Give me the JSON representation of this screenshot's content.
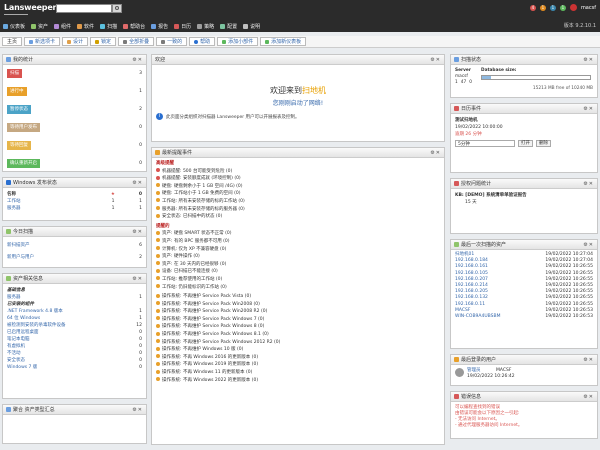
{
  "header": {
    "logo": "Lansweeper",
    "version": "版本 9.2.10.1",
    "username": "macsf",
    "badges": [
      {
        "count": "4",
        "color": "#d9534f"
      },
      {
        "count": "1",
        "color": "#e08a1e"
      },
      {
        "count": "1",
        "color": "#3a87ad"
      },
      {
        "count": "1",
        "color": "#5cb85c"
      }
    ]
  },
  "nav": [
    {
      "label": "仪表板",
      "icon": "dashboard-icon"
    },
    {
      "label": "资产",
      "icon": "assets-icon"
    },
    {
      "label": "组件",
      "icon": "components-icon"
    },
    {
      "label": "软件",
      "icon": "software-icon"
    },
    {
      "label": "扫描",
      "icon": "scan-icon"
    },
    {
      "label": "帮助台",
      "icon": "helpdesk-icon"
    },
    {
      "label": "报告",
      "icon": "reports-icon"
    },
    {
      "label": "日历",
      "icon": "calendar-icon"
    },
    {
      "label": "策略",
      "icon": "policy-icon"
    },
    {
      "label": "配置",
      "icon": "config-icon"
    },
    {
      "label": "说明",
      "icon": "help-icon"
    }
  ],
  "toolbar": [
    {
      "label": "主页",
      "icon": "home-icon"
    },
    {
      "label": "新选项卡",
      "icon": "tab-icon"
    },
    {
      "label": "设计",
      "icon": "design-icon"
    },
    {
      "label": "锁定",
      "icon": "lock-icon"
    },
    {
      "label": "全部折叠",
      "icon": "collapse-icon"
    },
    {
      "label": "一致的",
      "icon": "align-icon"
    },
    {
      "label": "帮助",
      "icon": "help-icon"
    },
    {
      "label": "添加小部件",
      "icon": "add-widget-icon"
    },
    {
      "label": "添加新仪表板",
      "icon": "add-dashboard-icon"
    }
  ],
  "left": {
    "status_panel": {
      "title": "我的统计",
      "items": [
        {
          "label": "扫描",
          "color": "#d9534f",
          "value": "3"
        },
        {
          "label": "进行中",
          "color": "#e8a02a",
          "value": "1"
        },
        {
          "label": "暂停状态",
          "color": "#4ba3c7",
          "value": "2"
        },
        {
          "label": "等待用户发布",
          "color": "#c5a882",
          "value": "0"
        },
        {
          "label": "等待回复",
          "color": "#e6b54a",
          "value": "0"
        },
        {
          "label": "确认重新开启",
          "color": "#5cb85c",
          "value": "0"
        }
      ]
    },
    "windows_panel": {
      "title": "Windows 发布状态",
      "headers": [
        "名称",
        "★",
        "0"
      ],
      "rows": [
        {
          "label": "工作站",
          "a": "1",
          "b": "1"
        },
        {
          "label": "服务器",
          "a": "1",
          "b": "1"
        }
      ]
    },
    "tag_panel": {
      "title": "今日扫描",
      "rows": [
        {
          "label": "新扫描资产",
          "value": "6"
        },
        {
          "label": "新用户与用户",
          "value": "2"
        }
      ]
    },
    "assets_panel": {
      "title": "资产相关信息",
      "sections": [
        {
          "head": "基础信息",
          "rows": [
            {
              "label": "服务器",
              "value": "1"
            }
          ]
        },
        {
          "head": "已安装的组件",
          "rows": [
            {
              "label": ".NET Framework 4.8 版本",
              "value": "1"
            },
            {
              "label": "64 位 Windows",
              "value": "1"
            },
            {
              "label": "被检测到安装的杀毒软件设备",
              "value": "12"
            },
            {
              "label": "已启用远程桌面",
              "value": "0"
            },
            {
              "label": "笔记本电脑",
              "value": "0"
            },
            {
              "label": "有虚拟机",
              "value": "0"
            },
            {
              "label": "不活动",
              "value": "0"
            },
            {
              "label": "安全状态",
              "value": "0"
            },
            {
              "label": "Windows 7 版",
              "value": "0"
            }
          ]
        }
      ]
    },
    "last_panel": {
      "title": "聚合 资产类型汇总"
    }
  },
  "center": {
    "welcome_panel": {
      "title": "欢迎",
      "line1_prefix": "欢迎来到",
      "line1_highlight": "扫地机",
      "line2": "您刚刚启动了网络!",
      "info": "此页面分类组织对扫描器 Lansweeper 用户可以开展报表及控制。"
    },
    "alerts_panel": {
      "title": "最新提醒事件",
      "sections": [
        {
          "head": "高级提醒",
          "items": [
            {
              "color": "#d9534f",
              "text": "机器提醒: 500 台可能受到危险 (0)"
            },
            {
              "color": "#d9534f",
              "text": "机器提醒: 安装额度成就 (环境控制) (0)"
            },
            {
              "color": "#e8a02a",
              "text": "硬盘: 硬盘剩余小于 1 GB 空间 /4G) (0)"
            },
            {
              "color": "#e8a02a",
              "text": "硬盘: 工作站小于 1 GB 免费的空间 (0)"
            },
            {
              "color": "#e8a02a",
              "text": "工作站: 所有未安装存储的标的工作站 (0)"
            },
            {
              "color": "#e8a02a",
              "text": "服务器: 所有未安装存储的标的服务器 (0)"
            },
            {
              "color": "#e8a02a",
              "text": "安全状态: 已扫描中的状态 (0)"
            }
          ]
        },
        {
          "head": "提醒的",
          "items": [
            {
              "color": "#e8a02a",
              "text": "资产: 硬盘 SMART 状态不正常 (0)"
            },
            {
              "color": "#e8a02a",
              "text": "资产: 有的 BPC 服务都不可用 (0)"
            },
            {
              "color": "#e8a02a",
              "text": "计算机: 仅为 XP 不兼容硬盘 (0)"
            },
            {
              "color": "#e8a02a",
              "text": "资产: 硬件操作 (0)"
            },
            {
              "color": "#e8a02a",
              "text": "资产: 在 30 天内的已经很够 (0)"
            },
            {
              "color": "#e8a02a",
              "text": "设备: 已扫描已不能连接 (0)"
            },
            {
              "color": "#e8a02a",
              "text": "工作站: 推荐使用的工作站 (0)"
            },
            {
              "color": "#e8a02a",
              "text": "工作站: 仍旧能标识的工作站 (0)"
            }
          ]
        },
        {
          "head": "",
          "items": [
            {
              "color": "#e8a02a",
              "text": "操作系统: 不再维护 Service Pack Vista (0)"
            },
            {
              "color": "#e8a02a",
              "text": "操作系统: 不再维护 Service Pack Win2008 (0)"
            },
            {
              "color": "#e8a02a",
              "text": "操作系统: 不再维护 Service Pack Win2008 R2 (0)"
            },
            {
              "color": "#e8a02a",
              "text": "操作系统: 不再维护 Service Pack Windows 7 (0)"
            },
            {
              "color": "#e8a02a",
              "text": "操作系统: 不再维护 Service Pack Windows 8 (0)"
            },
            {
              "color": "#e8a02a",
              "text": "操作系统: 不再维护 Service Pack Windows 8.1 (0)"
            },
            {
              "color": "#e8a02a",
              "text": "操作系统: 不再维护 Service Pack Windows 2012 R2 (0)"
            },
            {
              "color": "#e8a02a",
              "text": "操作系统: 不再维护 Windows 10 版 (0)"
            },
            {
              "color": "#e8a02a",
              "text": "操作系统: 不再 Windows 2016 的更新版本 (0)"
            },
            {
              "color": "#e8a02a",
              "text": "操作系统: 不再 Windows 2019 的更新版本 (0)"
            },
            {
              "color": "#e8a02a",
              "text": "操作系统: 不再 Windows 11 的更新版本 (0)"
            },
            {
              "color": "#e8a02a",
              "text": "操作系统: 不再 Windows 2022 的更新版本 (0)"
            }
          ]
        }
      ]
    }
  },
  "right": {
    "storage_panel": {
      "title": "扫描状态",
      "server_label": "Server",
      "server_value": "macsf",
      "db_label": "Database size:",
      "db_value": "15213 MB free of 10240 MB",
      "fill_percent": 8,
      "nums": [
        "1",
        "47",
        "0"
      ]
    },
    "calendar_panel": {
      "title": "日历事件",
      "event_title": "测试扫地机",
      "event_date": "19/02/2022 10:00:00",
      "event_status": "逾期 26 分钟",
      "select_value": "5分钟",
      "open_label": "打开",
      "dismiss_label": "删除"
    },
    "audit_panel": {
      "title": "授权问题统计",
      "title_line": "KB: [DEMO] 系统清单单验证报告",
      "days": "15 天"
    },
    "recent_panel": {
      "title": "最后一次扫描的资产",
      "rows": [
        {
          "name": "扫地机01",
          "date": "19/02/2022 10:27:04"
        },
        {
          "name": "192.168.0.184",
          "date": "19/02/2022 10:27:04"
        },
        {
          "name": "192.168.0.161",
          "date": "19/02/2022 10:26:55"
        },
        {
          "name": "192.168.0.105",
          "date": "19/02/2022 10:26:55"
        },
        {
          "name": "192.168.0.207",
          "date": "19/02/2022 10:26:55"
        },
        {
          "name": "192.168.0.214",
          "date": "19/02/2022 10:26:55"
        },
        {
          "name": "192.168.0.205",
          "date": "19/02/2022 10:26:55"
        },
        {
          "name": "192.168.0.132",
          "date": "19/02/2022 10:26:55"
        },
        {
          "name": "192.168.0.11",
          "date": "19/02/2022 10:26:55"
        },
        {
          "name": "MACSF",
          "date": "19/02/2022 10:26:53"
        },
        {
          "name": "WIN-COB9A4UBSBM",
          "date": "19/02/2022 10:26:53"
        }
      ]
    },
    "user_panel": {
      "title": "最后登录的用户",
      "name": "管理员",
      "host": "MACSF",
      "date": "19/02/2022 10:26:42"
    },
    "msg_panel": {
      "title": "错误信息",
      "subtitle": "可以编程查找到的错误",
      "lines": [
        "由错误可能会以下原因之一引起:",
        "- 无法访问 Internet。",
        "- 通过代理服务器访问 Internet。"
      ]
    }
  }
}
